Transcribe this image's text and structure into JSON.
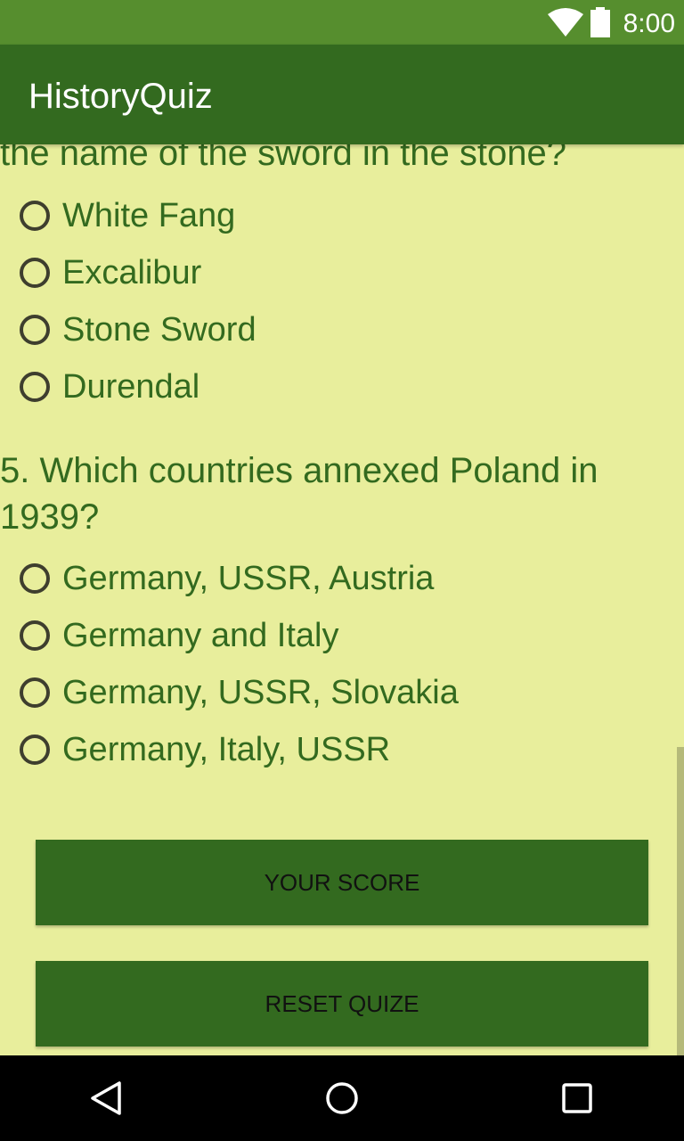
{
  "status_bar": {
    "time": "8:00",
    "icons": [
      "wifi-icon",
      "battery-icon"
    ]
  },
  "app_bar": {
    "title": "HistoryQuiz"
  },
  "question4": {
    "visible_text": "the name of the sword in the stone?",
    "options": [
      "White Fang",
      "Excalibur",
      "Stone Sword",
      "Durendal"
    ]
  },
  "question5": {
    "text": "5. Which countries annexed Poland in 1939?",
    "options": [
      "Germany, USSR, Austria",
      "Germany and Italy",
      "Germany, USSR, Slovakia",
      "Germany, Italy, USSR"
    ]
  },
  "buttons": {
    "score": "YOUR SCORE",
    "reset": "RESET QUIZE"
  },
  "colors": {
    "status_bar": "#568e2e",
    "primary": "#336a1f",
    "background": "#e8ee9c",
    "text": "#336a1f"
  },
  "nav_bar": {
    "icons": [
      "back-icon",
      "home-icon",
      "recents-icon"
    ]
  }
}
